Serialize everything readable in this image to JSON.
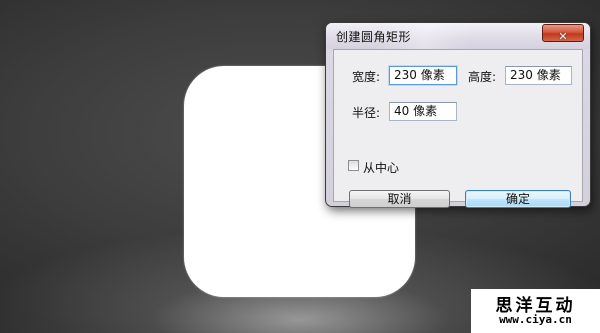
{
  "dialog": {
    "title": "创建圆角矩形",
    "close_glyph": "✕",
    "width_label": "宽度:",
    "width_value": "230 像素",
    "height_label": "高度:",
    "height_value": "230 像素",
    "radius_label": "半径:",
    "radius_value": "40 像素",
    "from_center_label": "从中心",
    "from_center_checked": false,
    "cancel_label": "取消",
    "ok_label": "确定"
  },
  "watermark": {
    "title": "思洋互动",
    "url": "www.ciya.cn"
  },
  "colors": {
    "background": "#3d3d3d",
    "shape_fill": "#ffffff",
    "close_button": "#c0391d",
    "default_button_border": "#3c7fb1"
  }
}
